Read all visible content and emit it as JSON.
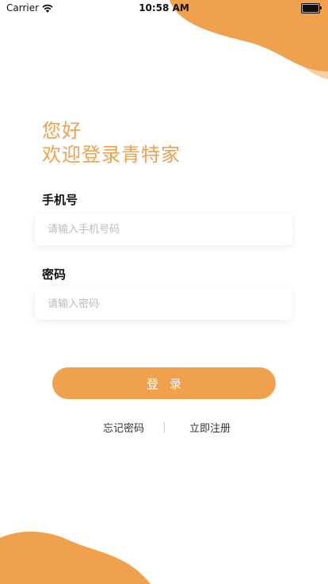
{
  "status_bar": {
    "carrier": "Carrier",
    "time": "10:58 AM",
    "battery_level": 1.0
  },
  "greeting": {
    "line1": "您好",
    "line2": "欢迎登录青特家"
  },
  "phone_field": {
    "label": "手机号",
    "placeholder": "请输入手机号码",
    "value": ""
  },
  "password_field": {
    "label": "密码",
    "placeholder": "请输入密码",
    "value": ""
  },
  "login_button": {
    "label": "登录"
  },
  "links": {
    "forgot_password": "忘记密码",
    "register": "立即注册"
  },
  "colors": {
    "accent": "#f0a14d",
    "accent_light": "#f8cfa2"
  },
  "icons": {
    "wifi": "wifi-icon",
    "battery": "battery-icon"
  }
}
